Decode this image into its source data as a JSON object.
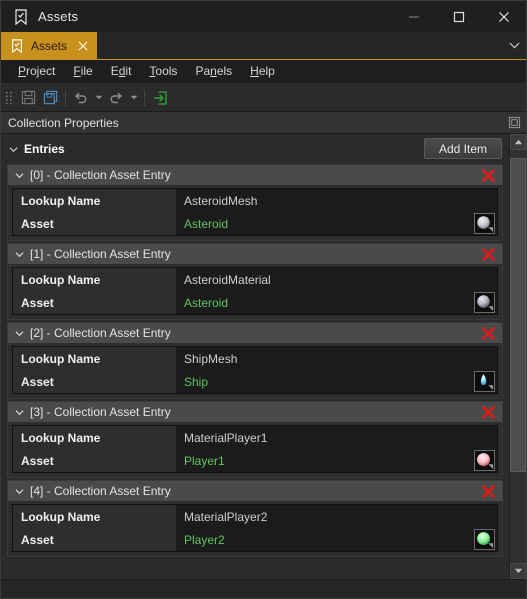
{
  "window": {
    "title": "Assets",
    "icon": "bookmark-check-icon",
    "controls": {
      "minimize": "minimize-icon",
      "maximize": "maximize-icon",
      "close": "close-icon"
    }
  },
  "tabbar": {
    "tabs": [
      {
        "label": "Assets",
        "icon": "bookmark-check-icon",
        "close": "close-icon",
        "active": true
      }
    ],
    "overflow": "chevron-down-icon"
  },
  "menubar": {
    "items": [
      {
        "label": "Project",
        "mnemonic": "P"
      },
      {
        "label": "File",
        "mnemonic": "F"
      },
      {
        "label": "Edit",
        "mnemonic": "d"
      },
      {
        "label": "Tools",
        "mnemonic": "T"
      },
      {
        "label": "Panels",
        "mnemonic": "n"
      },
      {
        "label": "Help",
        "mnemonic": "H"
      }
    ]
  },
  "toolbar": {
    "grip": "drag-grip-icon",
    "buttons": [
      {
        "name": "save-button",
        "icon": "save-floppy-icon",
        "enabled": false
      },
      {
        "name": "save-all-button",
        "icon": "save-all-floppy-icon",
        "enabled": true
      },
      {
        "name": "undo-button",
        "icon": "undo-arrow-icon",
        "enabled": false,
        "dropdown": true
      },
      {
        "name": "redo-button",
        "icon": "redo-arrow-icon",
        "enabled": false,
        "dropdown": true
      },
      {
        "name": "export-button",
        "icon": "arrow-into-box-icon",
        "enabled": true
      }
    ]
  },
  "panel": {
    "title": "Collection Properties",
    "float_button_icon": "undock-window-icon"
  },
  "entries": {
    "label": "Entries",
    "collapse_icon": "chevron-down-icon",
    "add_button_label": "Add Item",
    "items": [
      {
        "title": "[0] - Collection Asset Entry",
        "lookup_label": "Lookup Name",
        "lookup_value": "AsteroidMesh",
        "asset_label": "Asset",
        "asset_value": "Asteroid",
        "thumb": {
          "name": "asteroid-mesh-thumbnail",
          "color": "#c8c8d2",
          "shape": "sphere"
        },
        "delete_icon": "delete-x-icon"
      },
      {
        "title": "[1] - Collection Asset Entry",
        "lookup_label": "Lookup Name",
        "lookup_value": "AsteroidMaterial",
        "asset_label": "Asset",
        "asset_value": "Asteroid",
        "thumb": {
          "name": "asteroid-material-thumbnail",
          "color": "#b9b9c6",
          "shape": "sphere"
        },
        "delete_icon": "delete-x-icon"
      },
      {
        "title": "[2] - Collection Asset Entry",
        "lookup_label": "Lookup Name",
        "lookup_value": "ShipMesh",
        "asset_label": "Asset",
        "asset_value": "Ship",
        "thumb": {
          "name": "ship-mesh-thumbnail",
          "color": "#6fd8f0",
          "shape": "teardrop"
        },
        "delete_icon": "delete-x-icon"
      },
      {
        "title": "[3] - Collection Asset Entry",
        "lookup_label": "Lookup Name",
        "lookup_value": "MaterialPlayer1",
        "asset_label": "Asset",
        "asset_value": "Player1",
        "thumb": {
          "name": "player1-material-thumbnail",
          "color": "#ffc4c8",
          "shape": "sphere"
        },
        "delete_icon": "delete-x-icon"
      },
      {
        "title": "[4] - Collection Asset Entry",
        "lookup_label": "Lookup Name",
        "lookup_value": "MaterialPlayer2",
        "asset_label": "Asset",
        "asset_value": "Player2",
        "thumb": {
          "name": "player2-material-thumbnail",
          "color": "#8ff29a",
          "shape": "sphere"
        },
        "delete_icon": "delete-x-icon"
      }
    ]
  },
  "scrollbar": {
    "up_icon": "scroll-up-arrow-icon",
    "down_icon": "scroll-down-arrow-icon",
    "thumb_top_pct": 2,
    "thumb_height_pct": 76
  },
  "colors": {
    "accent_tab": "#c8901d",
    "asset_text": "#5ec45e",
    "delete_x": "#d11f1f",
    "window_bg": "#2b2b2c"
  }
}
